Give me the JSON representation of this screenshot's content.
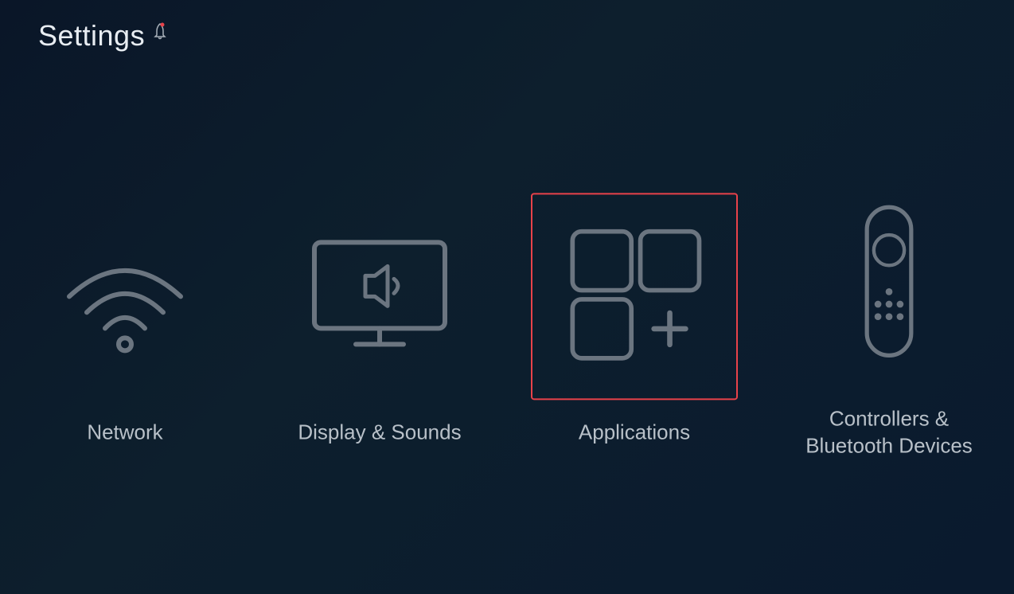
{
  "page": {
    "title": "Settings",
    "bell_icon": "🔔"
  },
  "items": [
    {
      "id": "network",
      "label": "Network",
      "selected": false
    },
    {
      "id": "display-sounds",
      "label": "Display & Sounds",
      "selected": false
    },
    {
      "id": "applications",
      "label": "Applications",
      "selected": true
    },
    {
      "id": "controllers",
      "label": "Controllers &\nBluetooth Devices",
      "selected": false
    }
  ],
  "colors": {
    "accent": "#e8424a",
    "icon_stroke": "#6b7580",
    "label": "#b8c0c8",
    "title": "#e8edf2"
  }
}
